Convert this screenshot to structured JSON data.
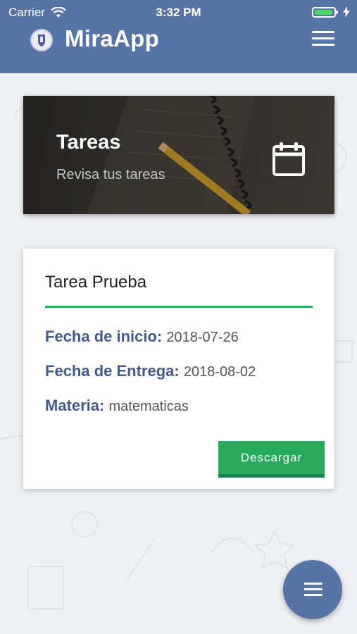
{
  "status_bar": {
    "carrier": "Carrier",
    "time": "3:32 PM"
  },
  "app_bar": {
    "title": "MiraApp"
  },
  "hero": {
    "title": "Tareas",
    "subtitle": "Revisa tus tareas"
  },
  "task_card": {
    "title": "Tarea Prueba",
    "start_label": "Fecha de inicio:",
    "start_value": "2018-07-26",
    "due_label": "Fecha de Entrega:",
    "due_value": "2018-08-02",
    "subject_label": "Materia:",
    "subject_value": "matematicas",
    "download_label": "Descargar"
  },
  "icons": [
    "wifi-icon",
    "battery-icon",
    "charging-icon",
    "school-logo",
    "hamburger-menu-icon",
    "calendar-icon"
  ],
  "colors": {
    "primary": "#5674a6",
    "accent_green": "#28aa5c",
    "label_blue": "#445b8a"
  }
}
